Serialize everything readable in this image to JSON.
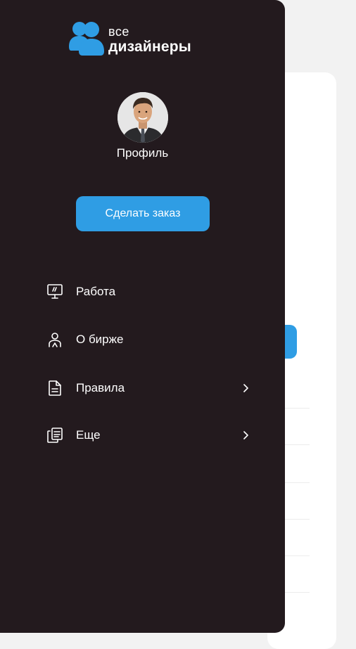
{
  "brand": {
    "line1": "все",
    "line2": "дизайнеры",
    "accent_color": "#2f9de4"
  },
  "profile": {
    "label": "Профиль"
  },
  "actions": {
    "order_button": "Сделать заказ"
  },
  "menu": {
    "items": [
      {
        "label": "Работа",
        "icon": "presentation-board-icon",
        "has_submenu": false
      },
      {
        "label": "О бирже",
        "icon": "person-icon",
        "has_submenu": false
      },
      {
        "label": "Правила",
        "icon": "document-icon",
        "has_submenu": true
      },
      {
        "label": "Еще",
        "icon": "copy-documents-icon",
        "has_submenu": true
      }
    ]
  },
  "colors": {
    "drawer_bg": "#231a1e",
    "text": "#ffffff"
  }
}
